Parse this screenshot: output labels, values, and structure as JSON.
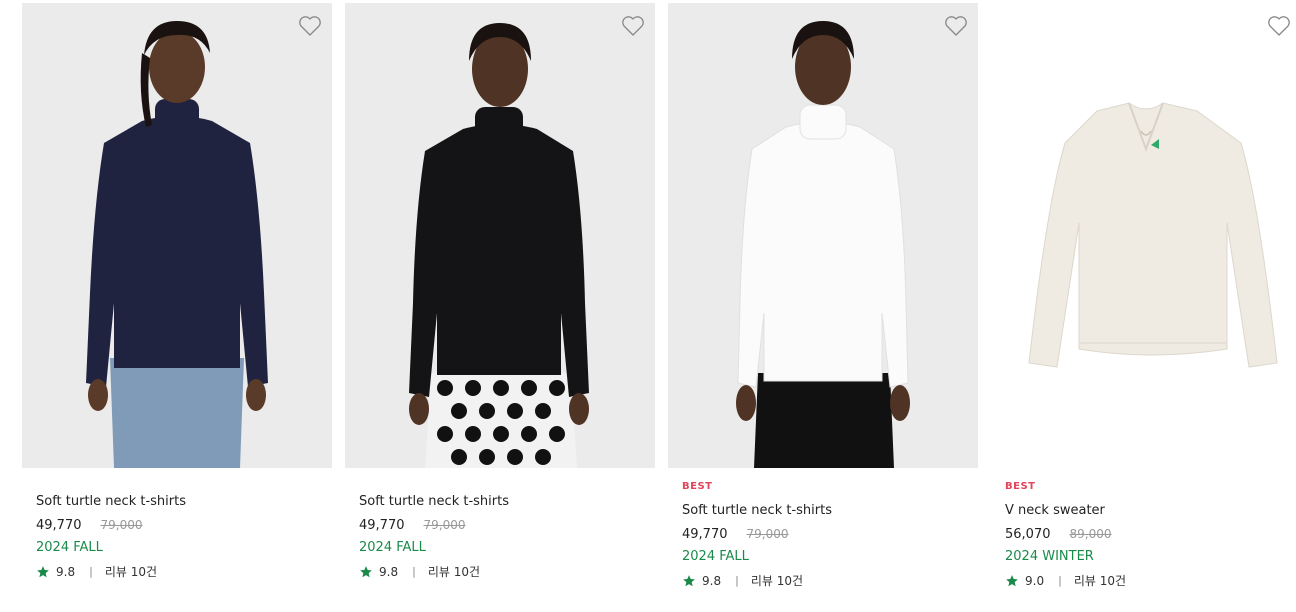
{
  "products": [
    {
      "badge": "",
      "name": "Soft turtle neck t-shirts",
      "price": "49,770",
      "original_price": "79,000",
      "season": "2024 FALL",
      "rating": "9.8",
      "reviews": "리뷰 10건",
      "image_desc": "navy turtleneck model",
      "top_color": "#1f2340",
      "bottom_color": "#7f9bb8"
    },
    {
      "badge": "",
      "name": "Soft turtle neck t-shirts",
      "price": "49,770",
      "original_price": "79,000",
      "season": "2024 FALL",
      "rating": "9.8",
      "reviews": "리뷰 10건",
      "image_desc": "black turtleneck model",
      "top_color": "#141416",
      "bottom_color": "#f2f2f2"
    },
    {
      "badge": "BEST",
      "name": "Soft turtle neck t-shirts",
      "price": "49,770",
      "original_price": "79,000",
      "season": "2024 FALL",
      "rating": "9.8",
      "reviews": "리뷰 10건",
      "image_desc": "white turtleneck model",
      "top_color": "#fbfbfb",
      "bottom_color": "#111111"
    },
    {
      "badge": "BEST",
      "name": "V neck sweater",
      "price": "56,070",
      "original_price": "89,000",
      "season": "2024 WINTER",
      "rating": "9.0",
      "reviews": "리뷰 10건",
      "image_desc": "cream v-neck sweater flat lay",
      "top_color": "#efebe3",
      "bottom_color": ""
    }
  ],
  "colors": {
    "badge": "#e0455b",
    "season": "#1a8a4a",
    "star": "#1a8a4a",
    "image_bg": "#ebebeb"
  },
  "icons": {
    "wishlist": "heart-outline-icon",
    "rating": "star-icon"
  }
}
